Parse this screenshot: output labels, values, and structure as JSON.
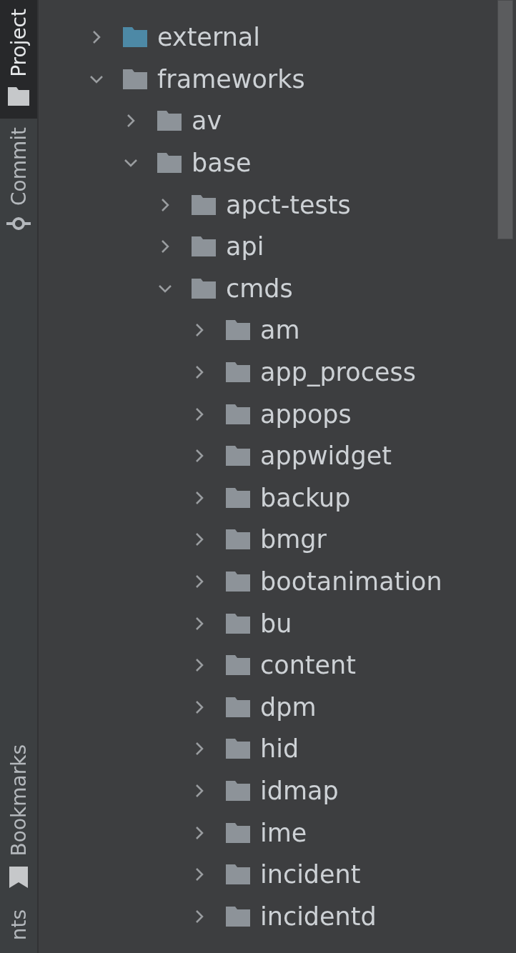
{
  "tool_window_bar": {
    "tabs": [
      {
        "label": "Project",
        "selected": true,
        "kind": "project"
      },
      {
        "label": "Commit",
        "selected": false,
        "kind": "commit"
      }
    ],
    "bottom_tabs": [
      {
        "label": "Bookmarks",
        "selected": false,
        "kind": "bookmarks"
      },
      {
        "label": "nts",
        "selected": false,
        "kind": "cut"
      }
    ]
  },
  "tree": [
    {
      "name": "external",
      "expanded": false,
      "color": "#4d89a6"
    },
    {
      "name": "frameworks",
      "expanded": true,
      "children": [
        {
          "name": "av",
          "expanded": false
        },
        {
          "name": "base",
          "expanded": true,
          "children": [
            {
              "name": "apct-tests",
              "expanded": false
            },
            {
              "name": "api",
              "expanded": false
            },
            {
              "name": "cmds",
              "expanded": true,
              "children": [
                {
                  "name": "am",
                  "expanded": false
                },
                {
                  "name": "app_process",
                  "expanded": false
                },
                {
                  "name": "appops",
                  "expanded": false
                },
                {
                  "name": "appwidget",
                  "expanded": false
                },
                {
                  "name": "backup",
                  "expanded": false
                },
                {
                  "name": "bmgr",
                  "expanded": false
                },
                {
                  "name": "bootanimation",
                  "expanded": false
                },
                {
                  "name": "bu",
                  "expanded": false
                },
                {
                  "name": "content",
                  "expanded": false
                },
                {
                  "name": "dpm",
                  "expanded": false
                },
                {
                  "name": "hid",
                  "expanded": false
                },
                {
                  "name": "idmap",
                  "expanded": false
                },
                {
                  "name": "ime",
                  "expanded": false
                },
                {
                  "name": "incident",
                  "expanded": false
                },
                {
                  "name": "incidentd",
                  "expanded": false
                }
              ]
            }
          ]
        }
      ]
    }
  ]
}
